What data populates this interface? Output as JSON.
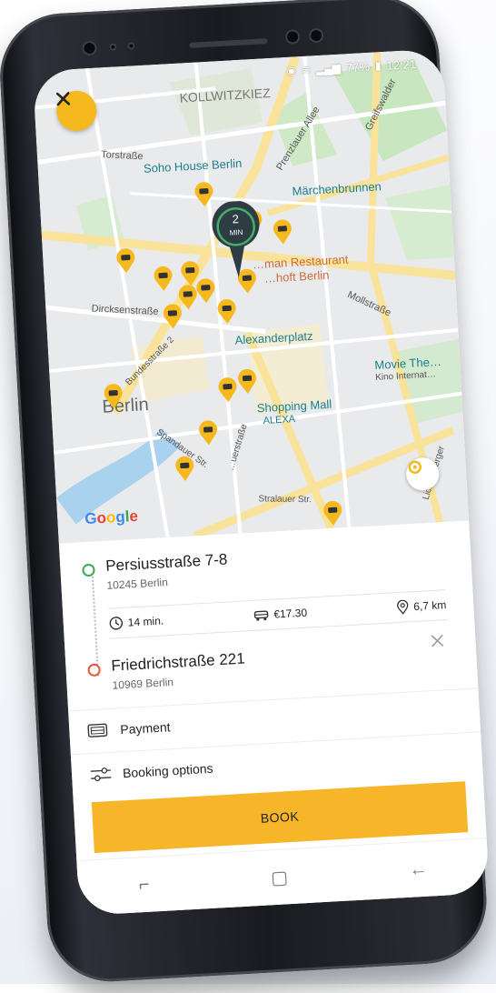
{
  "status": {
    "battery": "77%",
    "time": "12:21"
  },
  "map": {
    "labels": {
      "district_top": "KOLLWITZKIEZ",
      "torstrasse": "Torstraße",
      "soho": "Soho House Berlin",
      "prenzlauer": "Prenzlauer Allee",
      "greifswalder": "Greifswalder",
      "maerchen": "Märchenbrunnen",
      "restaurant": "…man Restaurant",
      "hoft": "…hoft Berlin",
      "dircksen": "Dircksenstraße",
      "moll": "Mollstraße",
      "bundesstrasse": "Bundesstraße 2",
      "alexanderplatz": "Alexanderplatz",
      "movie": "Movie The…",
      "kino": "Kino Internat…",
      "berlin": "Berlin",
      "mall": "Shopping Mall",
      "alexa": "ALEXA",
      "spandauer": "Spandauer Str.",
      "uber": "…uerstraße",
      "stralauer": "Stralauer Str.",
      "lichtenberger": "Lichtenberger",
      "google": "Google"
    },
    "eta": {
      "value": "2",
      "unit": "MIN"
    },
    "colors": {
      "taxi": "#f5b91e",
      "eta_pin": "#2e3d44",
      "eta_ring": "#43b067"
    }
  },
  "trip": {
    "pickup": {
      "name": "Persiusstraße 7-8",
      "sub": "10245 Berlin",
      "color": "#3aa757"
    },
    "dropoff": {
      "name": "Friedrichstraße 221",
      "sub": "10969 Berlin",
      "color": "#e8563b"
    },
    "metrics": {
      "time": "14 min.",
      "price": "€17.30",
      "distance": "6,7 km"
    }
  },
  "rows": {
    "payment": "Payment",
    "booking_options": "Booking options"
  },
  "actions": {
    "book": "BOOK"
  },
  "icons": {
    "close": "close-icon",
    "clock": "clock-icon",
    "car": "car-icon",
    "distance": "location-pin-icon",
    "payment": "payment-card-icon",
    "options": "sliders-icon",
    "locate": "locate-icon",
    "clear": "clear-icon"
  }
}
